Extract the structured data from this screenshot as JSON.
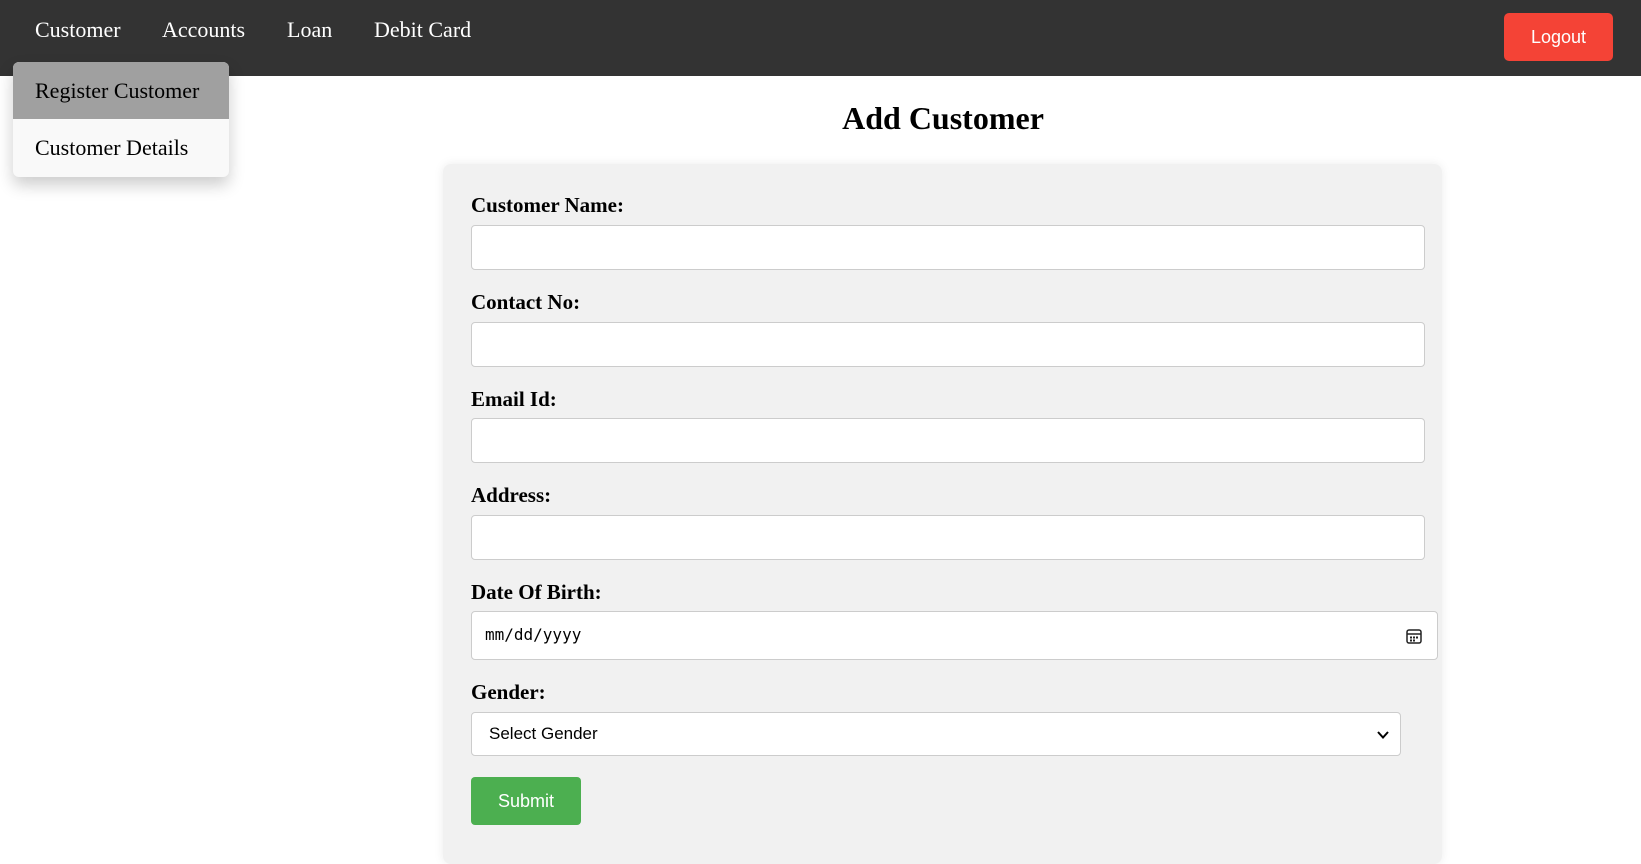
{
  "nav": {
    "items": [
      {
        "label": "Customer"
      },
      {
        "label": "Accounts"
      },
      {
        "label": "Loan"
      },
      {
        "label": "Debit Card"
      }
    ],
    "logout_label": "Logout",
    "logout_color": "#f44336"
  },
  "dropdown": {
    "items": [
      {
        "label": "Register Customer",
        "active": true
      },
      {
        "label": "Customer Details",
        "active": false
      }
    ]
  },
  "page": {
    "title": "Add Customer"
  },
  "form": {
    "customer_name_label": "Customer Name:",
    "customer_name_value": "",
    "contact_label": "Contact No:",
    "contact_value": "",
    "email_label": "Email Id:",
    "email_value": "",
    "address_label": "Address:",
    "address_value": "",
    "dob_label": "Date Of Birth:",
    "dob_placeholder": "mm/dd/yyyy",
    "gender_label": "Gender:",
    "gender_selected": "Select Gender",
    "submit_label": "Submit",
    "submit_color": "#4caf50"
  }
}
